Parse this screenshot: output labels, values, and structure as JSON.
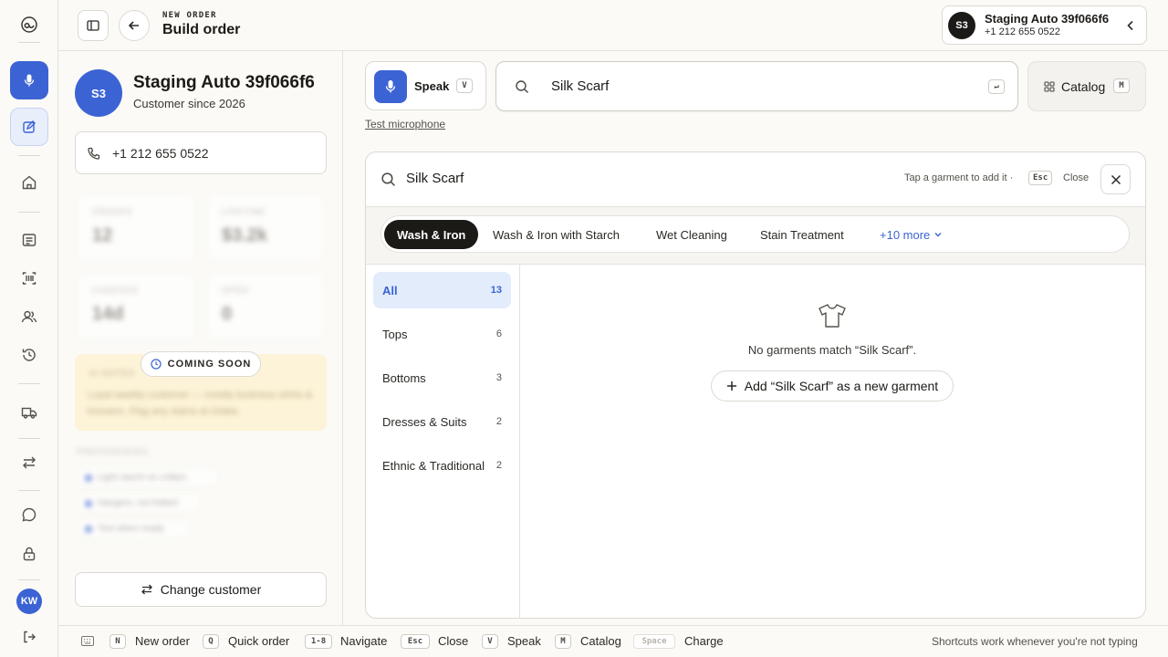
{
  "rail": {
    "user_initials": "KW"
  },
  "header": {
    "kicker": "NEW ORDER",
    "title": "Build order"
  },
  "customer_chip": {
    "initials": "S3",
    "name": "Staging Auto 39f066f6",
    "phone": "+1 212 655 0522"
  },
  "customer": {
    "initials": "S3",
    "name": "Staging Auto 39f066f6",
    "since": "Customer since 2026",
    "phone": "+1 212 655 0522",
    "stats": [
      {
        "label": "ORDERS",
        "value": "12"
      },
      {
        "label": "LIFETIME",
        "value": "$3.2k"
      },
      {
        "label": "CADENCE",
        "value": "14d"
      },
      {
        "label": "OPEN",
        "value": "0"
      }
    ],
    "coming_soon": "COMING SOON",
    "notes_blur_title": "AI NOTES",
    "notes_blur_text": "Loyal weekly customer — mostly business shirts & trousers. Flag any stains at intake.",
    "prefs_title": "PREFERENCES",
    "prefs": [
      "Light starch on collars",
      "Hangers, not folded",
      "Text when ready"
    ],
    "change_customer": "Change customer"
  },
  "toolbar": {
    "speak_label": "Speak",
    "speak_key": "V",
    "search_value": "Silk Scarf",
    "enter_key": "↵",
    "catalog_label": "Catalog",
    "catalog_key": "M",
    "test_mic": "Test microphone"
  },
  "results": {
    "query": "Silk Scarf",
    "hint": "Tap a garment to add it ·",
    "esc_key": "Esc",
    "close_label": "Close",
    "services": [
      "Wash & Iron",
      "Wash & Iron with Starch",
      "Wet Cleaning",
      "Stain Treatment"
    ],
    "more": "+10 more",
    "categories": [
      {
        "name": "All",
        "count": "13"
      },
      {
        "name": "Tops",
        "count": "6"
      },
      {
        "name": "Bottoms",
        "count": "3"
      },
      {
        "name": "Dresses & Suits",
        "count": "2"
      },
      {
        "name": "Ethnic & Traditional",
        "count": "2"
      }
    ],
    "empty_text": "No garments match “Silk Scarf”.",
    "add_new": "Add “Silk Scarf” as a new garment"
  },
  "footer": {
    "shortcuts": [
      {
        "key": "N",
        "label": "New order"
      },
      {
        "key": "Q",
        "label": "Quick order"
      },
      {
        "key": "1-8",
        "label": "Navigate"
      },
      {
        "key": "Esc",
        "label": "Close"
      },
      {
        "key": "V",
        "label": "Speak"
      },
      {
        "key": "M",
        "label": "Catalog"
      },
      {
        "key": "Space",
        "label": "Charge"
      }
    ],
    "note": "Shortcuts work whenever you're not typing"
  },
  "colors": {
    "accent": "#3b63d4",
    "dark": "#1c1a17",
    "selected_bg": "#e3ecfb",
    "warn_bg": "#fdf3d8"
  }
}
